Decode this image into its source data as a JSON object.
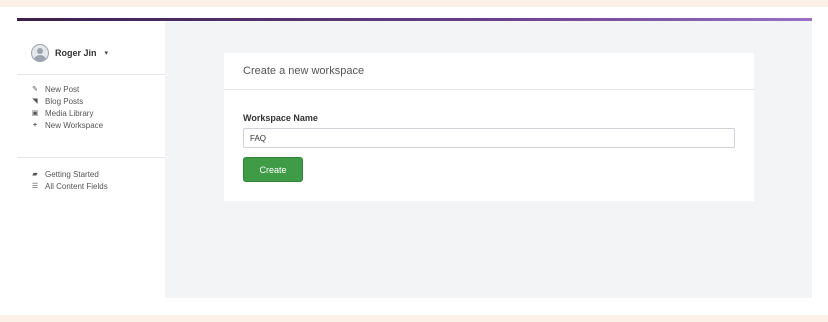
{
  "user": {
    "name": "Roger Jin",
    "caret": "▾"
  },
  "sidebar": {
    "group1": [
      {
        "label": "New Post",
        "icon": "pencil-icon"
      },
      {
        "label": "Blog Posts",
        "icon": "rss-icon"
      },
      {
        "label": "Media Library",
        "icon": "image-icon"
      },
      {
        "label": "New Workspace",
        "icon": "plus-icon"
      }
    ],
    "group2": [
      {
        "label": "Getting Started",
        "icon": "book-icon"
      },
      {
        "label": "All Content Fields",
        "icon": "list-icon"
      }
    ]
  },
  "card": {
    "title": "Create a new workspace",
    "field_label": "Workspace Name",
    "field_value": "FAQ",
    "button_label": "Create"
  },
  "colors": {
    "accent_gradient_start": "#3b1f4d",
    "accent_gradient_end": "#9a6ec3",
    "primary_button": "#3f9b45",
    "main_bg": "#f3f4f6",
    "page_bg": "#fbf1e6"
  }
}
